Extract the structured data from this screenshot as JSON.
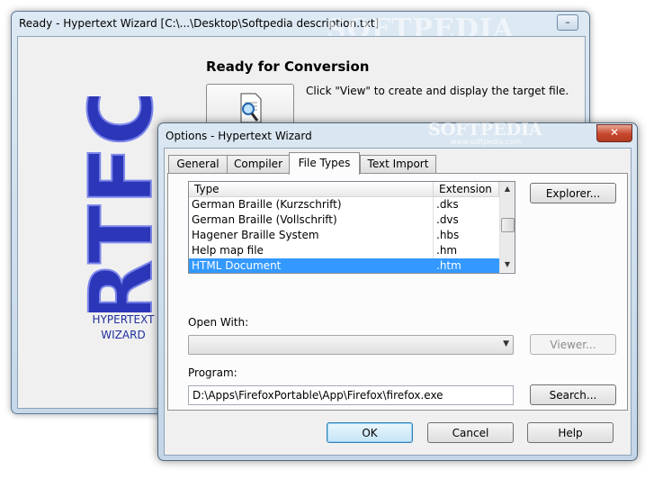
{
  "main_window": {
    "title": "Ready - Hypertext Wizard [C:\\...\\Desktop\\Softpedia description.txt]",
    "minimize": "–",
    "logo_text": "RTFC",
    "product_label_line1": "HYPERTEXT",
    "product_label_line2": "WIZARD",
    "heading": "Ready for Conversion",
    "description": "Click \"View\" to create and display the target file.",
    "watermark": "SOFTPEDIA"
  },
  "dialog": {
    "title": "Options - Hypertext Wizard",
    "close": "✕",
    "watermark": "SOFTPEDIA",
    "watermark_url": "www.softpedia.com",
    "tabs": [
      {
        "label": "General"
      },
      {
        "label": "Compiler"
      },
      {
        "label": "File Types",
        "active": true
      },
      {
        "label": "Text Import"
      }
    ],
    "file_types": {
      "columns": [
        "Type",
        "Extension"
      ],
      "rows": [
        {
          "type": "German Braille (Kurzschrift)",
          "ext": ".dks"
        },
        {
          "type": "German Braille (Vollschrift)",
          "ext": ".dvs"
        },
        {
          "type": "Hagener Braille System",
          "ext": ".hbs"
        },
        {
          "type": "Help map file",
          "ext": ".hm"
        },
        {
          "type": "HTML Document",
          "ext": ".htm",
          "selected": true
        }
      ],
      "selection_color": "#3399ff"
    },
    "explorer_button": "Explorer...",
    "open_with_label": "Open With:",
    "open_with_value": "",
    "viewer_button": "Viewer...",
    "program_label": "Program:",
    "program_value": "D:\\Apps\\FirefoxPortable\\App\\Firefox\\firefox.exe",
    "search_button": "Search...",
    "ok_button": "OK",
    "cancel_button": "Cancel",
    "help_button": "Help"
  }
}
